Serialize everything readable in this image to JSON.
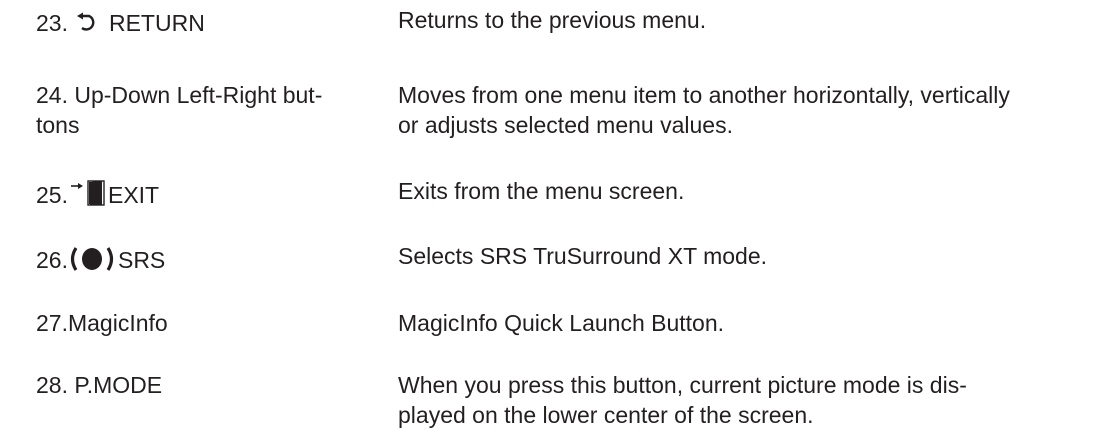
{
  "rows": [
    {
      "label": "23.",
      "icon": "return-arrow-icon",
      "label_suffix": "RETURN",
      "description": "Returns to the previous menu."
    },
    {
      "label_line1": "24. Up-Down Left-Right but-",
      "label_line2": "tons",
      "description_line1": "Moves from one menu item to another horizontally, vertically",
      "description_line2": "or adjusts selected menu values."
    },
    {
      "label": "25.",
      "icon": "exit-door-icon",
      "label_suffix": "EXIT",
      "description": "Exits from the menu screen."
    },
    {
      "label": "26.",
      "icon": "srs-speaker-icon",
      "label_suffix": "SRS",
      "description": "Selects SRS TruSurround XT mode."
    },
    {
      "label": "27.MagicInfo",
      "description": "MagicInfo Quick Launch Button."
    },
    {
      "label": "28. P.MODE",
      "description_line1": "When you press this button, current picture mode is dis-",
      "description_line2": "played on the lower center of the screen."
    }
  ]
}
